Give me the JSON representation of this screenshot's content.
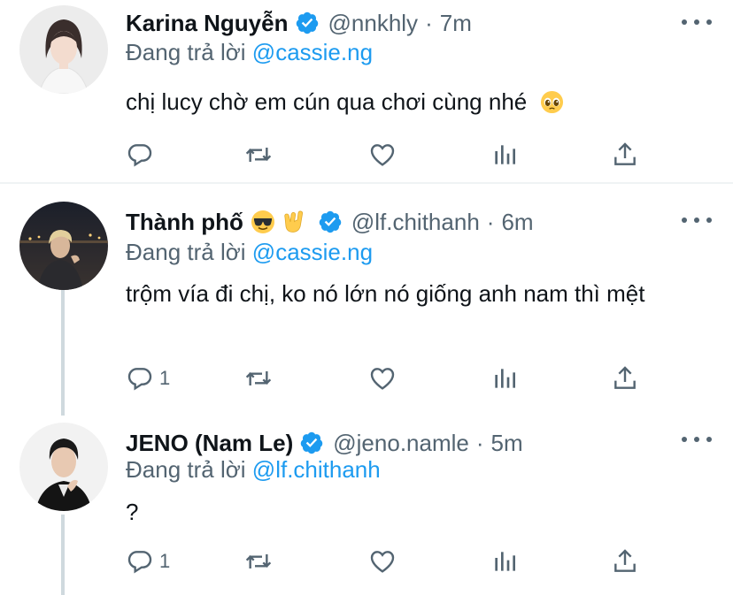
{
  "colors": {
    "link": "#1d9bf0",
    "secondary": "#536471",
    "text": "#0f1419",
    "verified": "#1d9bf0"
  },
  "tweets": [
    {
      "name": "Karina Nguyễn",
      "handle": "@nnkhly",
      "time": "7m",
      "replying_prefix": "Đang trả lời",
      "replying_to": "@cassie.ng",
      "text": "chị lucy chờ em cún qua chơi cùng nhé",
      "text_emoji": "pleading-face-emoji",
      "reply_count": "",
      "icons": [
        "reply-icon",
        "retweet-icon",
        "like-icon",
        "analytics-icon",
        "share-icon"
      ]
    },
    {
      "name": "Thành phố",
      "name_emojis": [
        "sunglasses-face-emoji",
        "rock-hand-emoji"
      ],
      "handle": "@lf.chithanh",
      "time": "6m",
      "replying_prefix": "Đang trả lời",
      "replying_to": "@cassie.ng",
      "text": "trộm vía đi chị, ko nó lớn nó giống anh nam thì mệt",
      "reply_count": "1",
      "icons": [
        "reply-icon",
        "retweet-icon",
        "like-icon",
        "analytics-icon",
        "share-icon"
      ]
    },
    {
      "name": "JENO (Nam Le)",
      "handle": "@jeno.namle",
      "time": "5m",
      "replying_prefix": "Đang trả lời",
      "replying_to": "@lf.chithanh",
      "text": "?",
      "reply_count": "1",
      "icons": [
        "reply-icon",
        "retweet-icon",
        "like-icon",
        "analytics-icon",
        "share-icon"
      ]
    }
  ]
}
